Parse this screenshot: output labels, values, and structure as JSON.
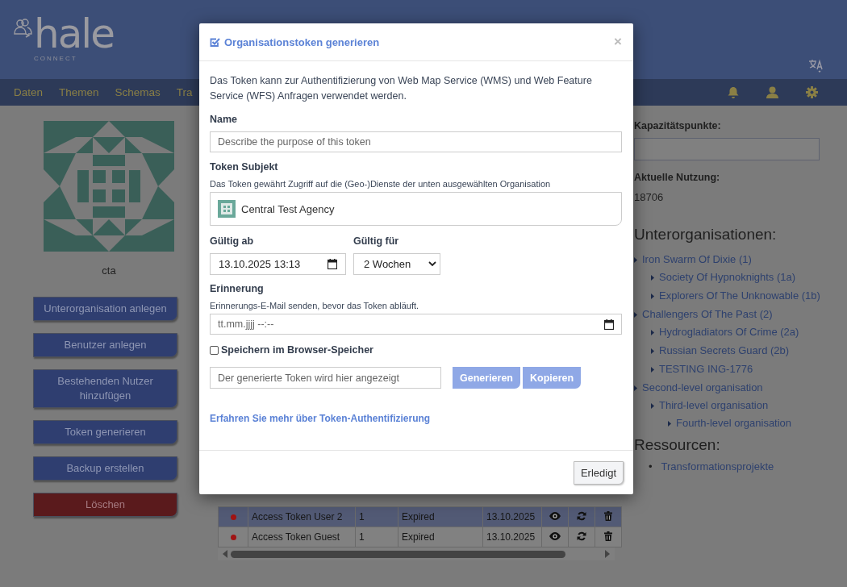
{
  "header": {
    "logo_text": "hale",
    "logo_subtext": "CONNECT"
  },
  "nav": {
    "items": [
      {
        "label": "Daten"
      },
      {
        "label": "Themen"
      },
      {
        "label": "Schemas"
      },
      {
        "label": "Tra"
      }
    ]
  },
  "sidebar": {
    "org_name": "cta",
    "buttons": [
      {
        "label": "Unterorganisation anlegen",
        "kind": "primary"
      },
      {
        "label": "Benutzer anlegen",
        "kind": "primary"
      },
      {
        "label": "Bestehenden Nutzer hinzufügen",
        "kind": "primary"
      },
      {
        "label": "Token generieren",
        "kind": "primary"
      },
      {
        "label": "Backup erstellen",
        "kind": "primary"
      },
      {
        "label": "Löschen",
        "kind": "danger"
      }
    ]
  },
  "tokens_table": {
    "rows": [
      {
        "color": "#a01414",
        "name": "Access Token User 2",
        "count": "1",
        "status": "Expired",
        "date": "13.10.2025",
        "selected": true
      },
      {
        "color": "#a01414",
        "name": "Access Token Guest",
        "count": "1",
        "status": "Expired",
        "date": "13.10.2025",
        "selected": false
      }
    ]
  },
  "details": {
    "capacity_label": "Kapazitätspunkte:",
    "usage_label": "Aktuelle Nutzung:",
    "usage_value": "18706",
    "suborgs_heading": "Unterorganisationen:",
    "suborgs": [
      {
        "label": "Iron Swarm Of Dixie (1)",
        "children": [
          {
            "label": "Society Of Hypnoknights (1a)"
          },
          {
            "label": "Explorers Of The Unknowable (1b)"
          }
        ]
      },
      {
        "label": "Challengers Of The Past (2)",
        "children": [
          {
            "label": "Hydrogladiators Of Crime (2a)"
          },
          {
            "label": "Russian Secrets Guard (2b)"
          },
          {
            "label": "TESTING ING-1776"
          }
        ]
      },
      {
        "label": "Second-level organisation",
        "children": [
          {
            "label": "Third-level organisation",
            "children": [
              {
                "label": "Fourth-level organisation"
              }
            ]
          }
        ]
      }
    ],
    "resources_heading": "Ressourcen:",
    "resources": [
      {
        "bullet": "•",
        "label": "Transformationsprojekte"
      }
    ]
  },
  "modal": {
    "title": "Organisationstoken generieren",
    "close": "×",
    "intro": "Das Token kann zur Authentifizierung von Web Map Service (WMS) und Web Feature Service (WFS) Anfragen verwendet werden.",
    "name_label": "Name",
    "name_placeholder": "Describe the purpose of this token",
    "subject_label": "Token Subjekt",
    "subject_hint": "Das Token gewährt Zugriff auf die (Geo-)Dienste der unten ausgewählten Organisation",
    "subject_org": "Central Test Agency",
    "valid_from_label": "Gültig ab",
    "valid_from_value": "13.10.2025 13:13",
    "valid_for_label": "Gültig für",
    "valid_for_value": "2 Wochen",
    "reminder_label": "Erinnerung",
    "reminder_hint": "Erinnerungs-E-Mail senden, bevor das Token abläuft.",
    "reminder_placeholder": "tt.mm.jjjj --:--",
    "store": {
      "label": "Speichern im Browser-Speicher",
      "checked": false
    },
    "token_placeholder": "Der generierte Token wird hier angezeigt",
    "buttons": [
      "Generieren",
      "Kopieren"
    ],
    "link": "Erfahren Sie mehr über Token-Authentifizierung",
    "done": "Erledigt"
  }
}
